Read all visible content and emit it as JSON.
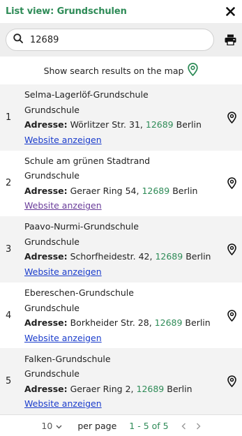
{
  "header": {
    "title": "List view: Grundschulen"
  },
  "search": {
    "value": "12689"
  },
  "map_link": {
    "label": "Show search results on the map"
  },
  "results": [
    {
      "num": "1",
      "name": "Selma-Lagerlöf-Grundschule",
      "type": "Grundschule",
      "addr_label": "Adresse:",
      "street": "Wörlitzer Str. 31,",
      "zip": "12689",
      "city": "Berlin",
      "link": "Website anzeigen"
    },
    {
      "num": "2",
      "name": "Schule am grünen Stadtrand",
      "type": "Grundschule",
      "addr_label": "Adresse:",
      "street": "Geraer Ring 54,",
      "zip": "12689",
      "city": "Berlin",
      "link": "Website anzeigen"
    },
    {
      "num": "3",
      "name": "Paavo-Nurmi-Grundschule",
      "type": "Grundschule",
      "addr_label": "Adresse:",
      "street": "Schorfheidestr. 42,",
      "zip": "12689",
      "city": "Berlin",
      "link": "Website anzeigen"
    },
    {
      "num": "4",
      "name": "Ebereschen-Grundschule",
      "type": "Grundschule",
      "addr_label": "Adresse:",
      "street": "Borkheider Str. 28,",
      "zip": "12689",
      "city": "Berlin",
      "link": "Website anzeigen"
    },
    {
      "num": "5",
      "name": "Falken-Grundschule",
      "type": "Grundschule",
      "addr_label": "Adresse:",
      "street": "Geraer Ring 2,",
      "zip": "12689",
      "city": "Berlin",
      "link": "Website anzeigen"
    }
  ],
  "pager": {
    "page_size": "10",
    "per_page_label": "per page",
    "range": "1 - 5 of 5"
  },
  "icons": {
    "close": "close-icon",
    "search": "search-icon",
    "print": "printer-icon",
    "map_pin": "map-pin-icon",
    "chevron_down": "chevron-down-icon",
    "prev": "chevron-left-icon",
    "next": "chevron-right-icon"
  },
  "colors": {
    "accent_green": "#2e8b57",
    "link_blue": "#1a3ccc",
    "link_visited": "#6a3d9a"
  }
}
